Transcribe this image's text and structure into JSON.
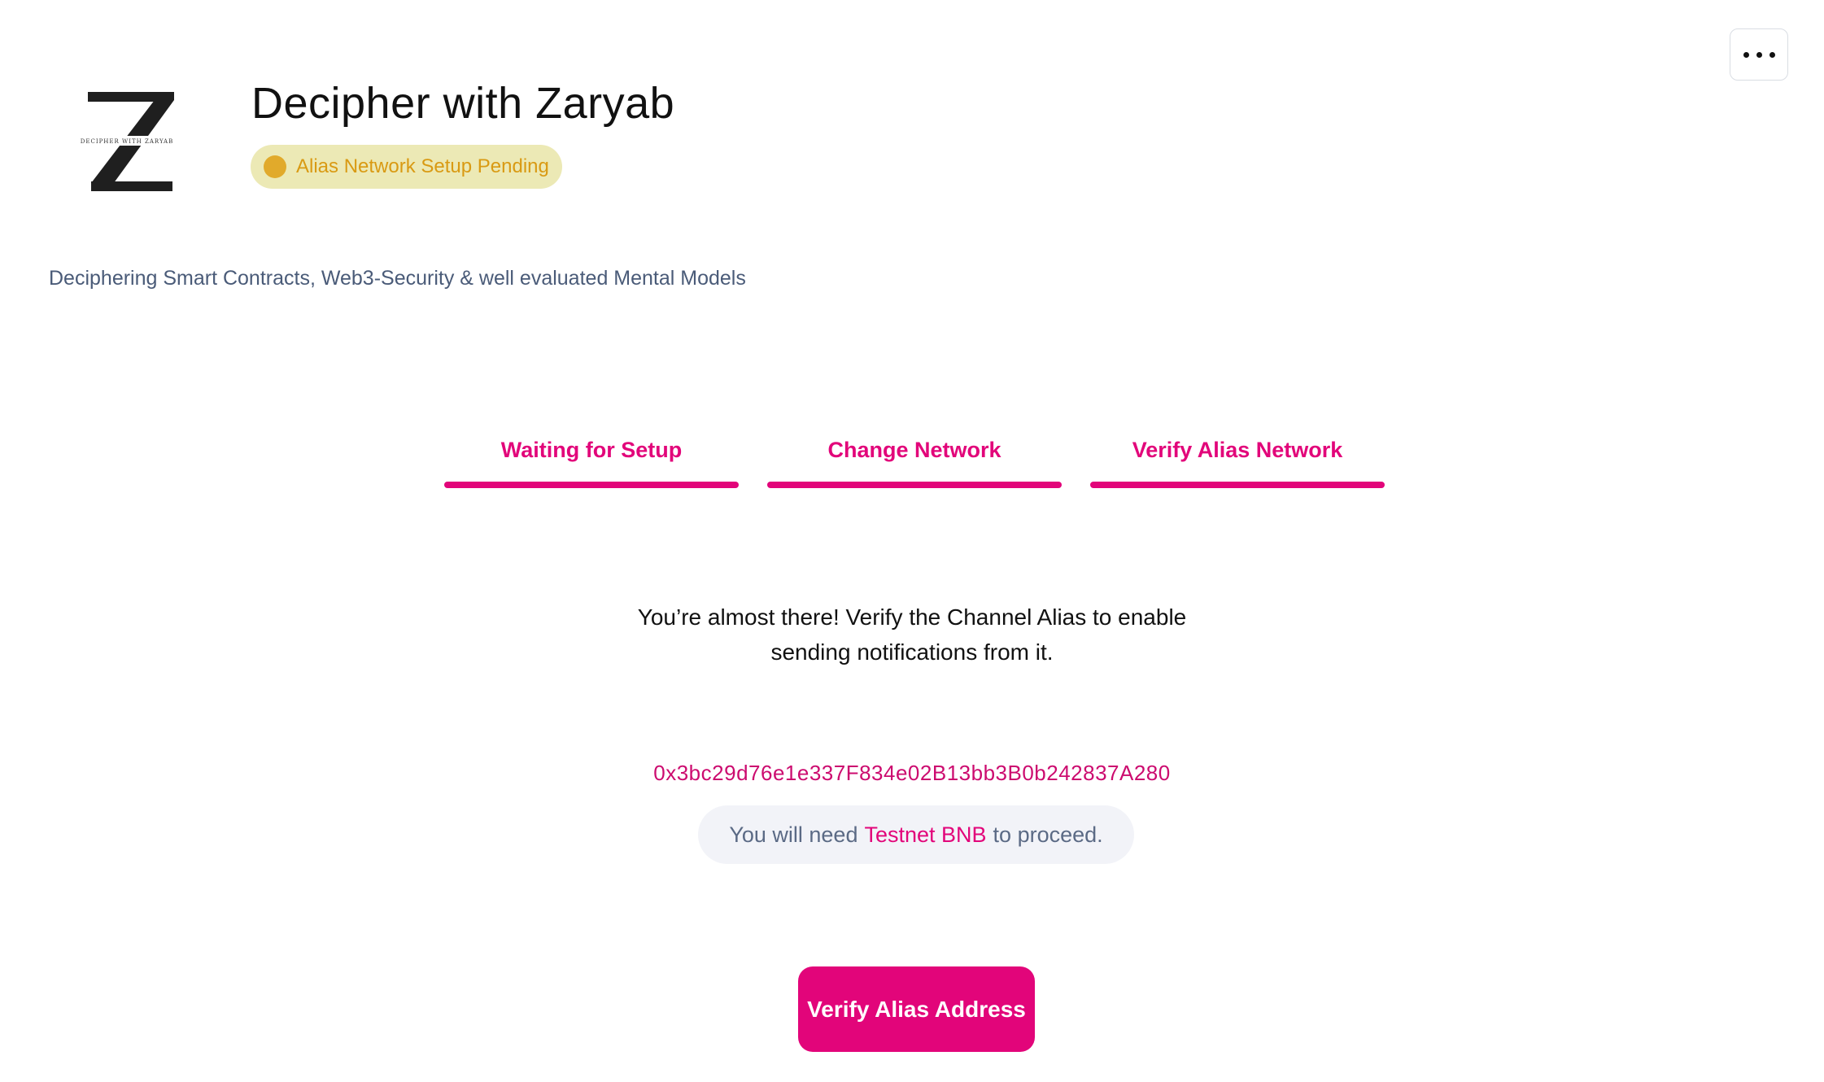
{
  "menu": {
    "icon": "more-horizontal-icon"
  },
  "channel": {
    "logo_icon": "channel-logo-z",
    "logo_caption": "DECIPHER WITH ZARYAB",
    "title": "Decipher with Zaryab",
    "status": "Alias Network Setup Pending",
    "status_color": "#e1aa2b",
    "description": "Deciphering Smart Contracts, Web3-Security & well evaluated Mental Models"
  },
  "steps": [
    {
      "label": "Waiting for Setup"
    },
    {
      "label": "Change Network"
    },
    {
      "label": "Verify Alias Network"
    }
  ],
  "accent_color": "#e2057a",
  "verify": {
    "message_line1": "You’re almost there! Verify the Channel Alias to enable",
    "message_line2": "sending notifications from it.",
    "alias_address": "0x3bc29d76e1e337F834e02B13bb3B0b242837A280",
    "need_prefix": "You will need",
    "need_token": "Testnet BNB",
    "need_suffix": "to proceed.",
    "button_label": "Verify Alias Address"
  }
}
